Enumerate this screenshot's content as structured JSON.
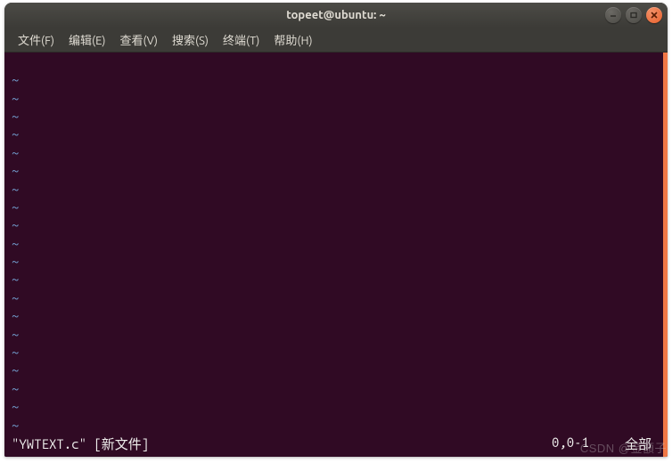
{
  "titlebar": {
    "title": "topeet@ubuntu: ~"
  },
  "menubar": {
    "items": [
      {
        "label": "文件(F)"
      },
      {
        "label": "编辑(E)"
      },
      {
        "label": "查看(V)"
      },
      {
        "label": "搜索(S)"
      },
      {
        "label": "终端(T)"
      },
      {
        "label": "帮助(H)"
      }
    ]
  },
  "terminal": {
    "blank_line": "",
    "tilde": "~",
    "tilde_rows": 20,
    "status_left": "\"YWTEXT.c\" [新文件]",
    "status_cursor": "0,0-1",
    "status_mode": "全部"
  },
  "watermark": "CSDN @金額子",
  "colors": {
    "terminal_bg": "#300a24",
    "tilde": "#729fcf",
    "text": "#eeeeec",
    "close_btn": "#e8602c",
    "scrollbar": "#f07746"
  }
}
